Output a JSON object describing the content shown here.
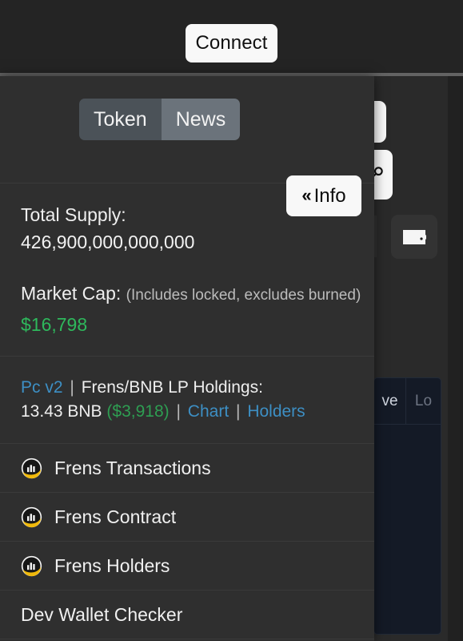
{
  "topbar": {
    "connect_label": "Connect"
  },
  "panel": {
    "header": {
      "segmented": [
        {
          "label": "Token",
          "active": false
        },
        {
          "label": "News",
          "active": true
        }
      ],
      "info_button": {
        "chevron": "«",
        "label": "Info"
      }
    },
    "stats": {
      "total_supply_label": "Total Supply:",
      "total_supply_value": "426,900,000,000,000",
      "market_cap_label": "Market Cap:",
      "market_cap_note": "(Includes locked, excludes burned)",
      "market_cap_value": "$16,798"
    },
    "lp": {
      "dex_link": "Pc v2",
      "pipe": "|",
      "title": "Frens/BNB LP Holdings:",
      "amount": "13.43 BNB",
      "amount_usd": "($3,918)",
      "chart_link": "Chart",
      "holders_link": "Holders"
    },
    "menu": [
      {
        "label": "Frens Transactions",
        "icon": "bscscan-icon"
      },
      {
        "label": "Frens Contract",
        "icon": "bscscan-icon"
      },
      {
        "label": "Frens Holders",
        "icon": "bscscan-icon"
      },
      {
        "label": "Dev Wallet Checker",
        "icon": ""
      }
    ]
  },
  "background": {
    "navy_card_tabs": [
      {
        "label": "ve"
      },
      {
        "label": "Lo"
      }
    ]
  },
  "colors": {
    "panel_bg": "#2f2f2f",
    "accent_link": "#3d8fc4",
    "money_green": "#2eb85c",
    "segment_active": "#6b737b",
    "segment_inactive": "#4b5258",
    "button_white": "#f8f8f8",
    "icon_gold": "#f0b90b"
  }
}
